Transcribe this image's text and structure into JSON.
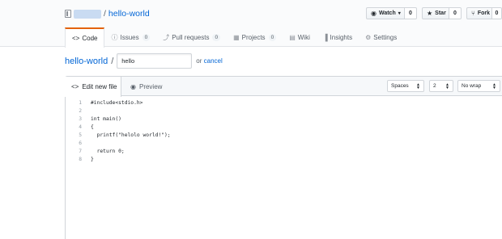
{
  "repo": {
    "name": "hello-world",
    "separator": "/"
  },
  "actions": {
    "watch": {
      "label": "Watch",
      "count": "0"
    },
    "star": {
      "label": "Star",
      "count": "0"
    },
    "fork": {
      "label": "Fork",
      "count": "0"
    }
  },
  "tabs": [
    {
      "label": "Code",
      "icon": "code-icon",
      "selected": true
    },
    {
      "label": "Issues",
      "icon": "issue-icon",
      "count": "0"
    },
    {
      "label": "Pull requests",
      "icon": "pull-request-icon",
      "count": "0"
    },
    {
      "label": "Projects",
      "icon": "project-icon",
      "count": "0"
    },
    {
      "label": "Wiki",
      "icon": "book-icon"
    },
    {
      "label": "Insights",
      "icon": "graph-icon"
    },
    {
      "label": "Settings",
      "icon": "gear-icon"
    }
  ],
  "breadcrumb": {
    "repo": "hello-world",
    "separator": "/",
    "filename_value": "hello",
    "or_text": "or",
    "cancel_label": "cancel"
  },
  "editor": {
    "edit_tab": "Edit new file",
    "preview_tab": "Preview",
    "indent_mode": "Spaces",
    "indent_size": "2",
    "wrap_mode": "No wrap",
    "lines": [
      {
        "n": "1",
        "text": "#include<stdio.h>"
      },
      {
        "n": "2",
        "text": ""
      },
      {
        "n": "3",
        "text": "int main()"
      },
      {
        "n": "4",
        "text": "{"
      },
      {
        "n": "5",
        "text": "  printf(\"helolo world!\");"
      },
      {
        "n": "6",
        "text": ""
      },
      {
        "n": "7",
        "text": "  return 0;"
      },
      {
        "n": "8",
        "text": "}"
      }
    ]
  },
  "colors": {
    "link": "#0366d6",
    "selected_tab_accent": "#e36209",
    "border": "#d1d5da"
  }
}
